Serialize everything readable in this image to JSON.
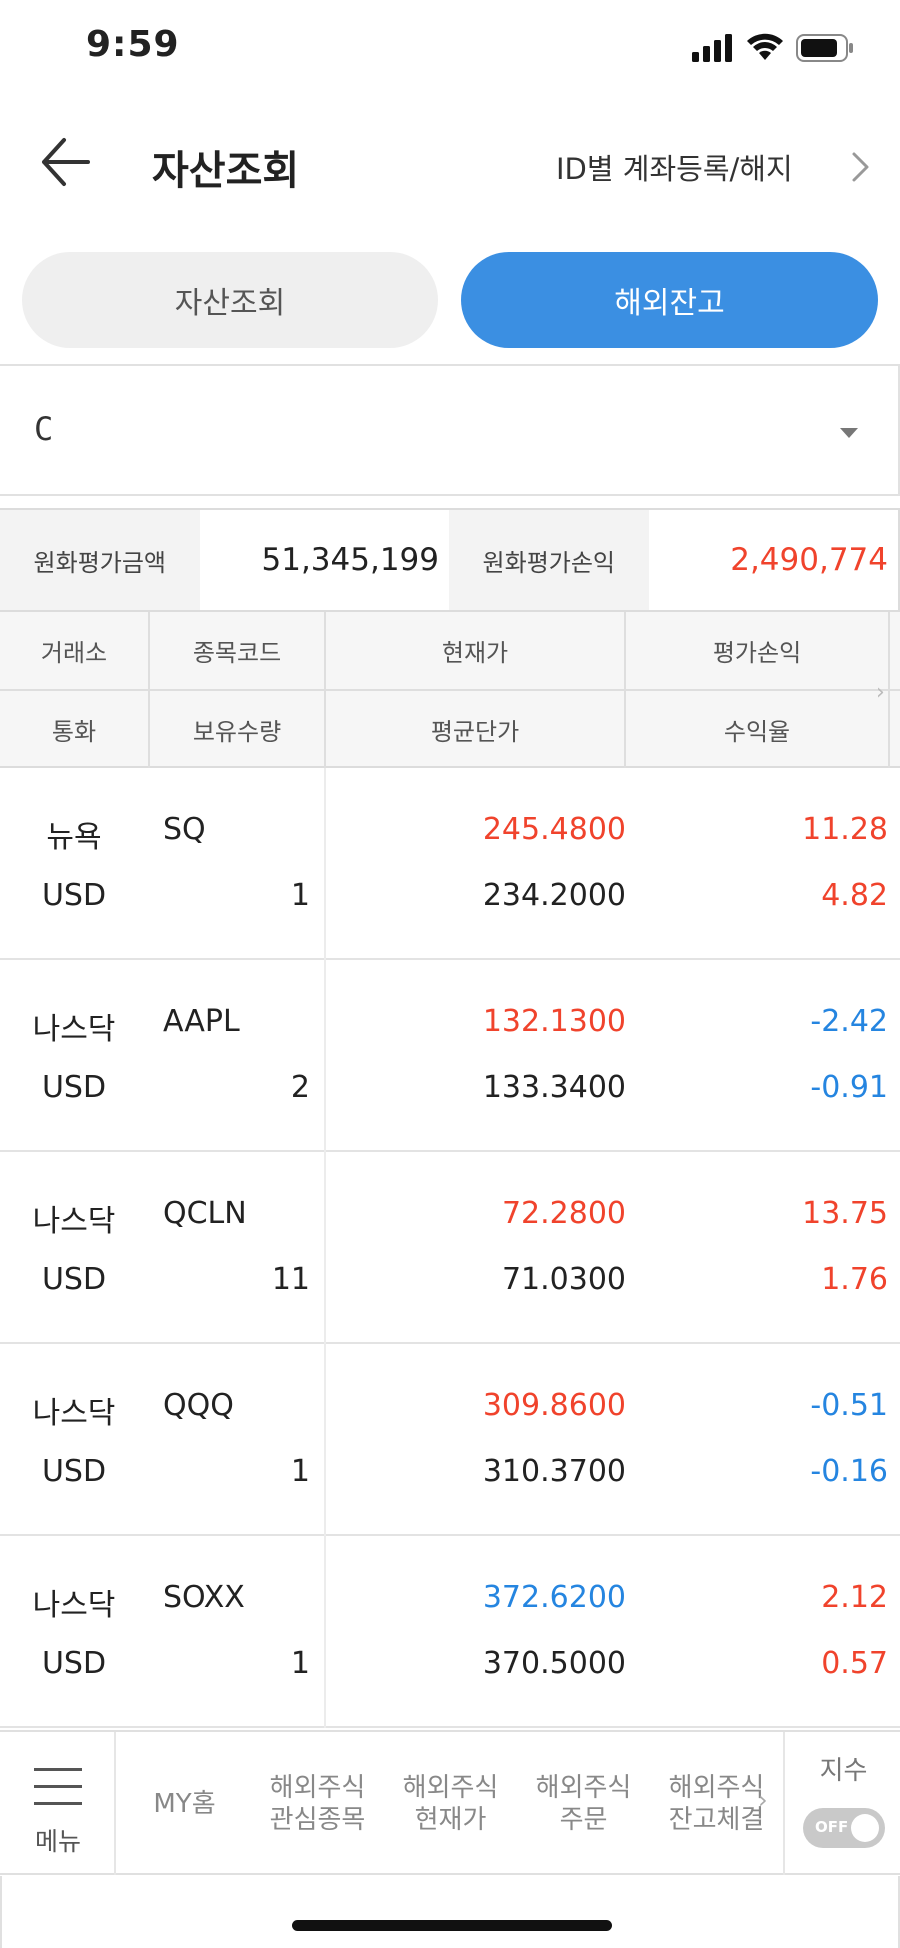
{
  "status": {
    "time": "9:59"
  },
  "header": {
    "title": "자산조회",
    "link": "ID별 계좌등록/해지"
  },
  "tabs": [
    {
      "label": "자산조회",
      "active": false
    },
    {
      "label": "해외잔고",
      "active": true
    }
  ],
  "account": {
    "value": "C"
  },
  "summary": {
    "krw_eval_amount_label": "원화평가금액",
    "krw_eval_amount": "51,345,199",
    "krw_eval_pl_label": "원화평가손익",
    "krw_eval_pl": "2,490,774"
  },
  "columns": {
    "exchange": "거래소",
    "code": "종목코드",
    "price": "현재가",
    "pl": "평가손익",
    "currency": "통화",
    "qty": "보유수량",
    "avg": "평균단가",
    "rate": "수익율"
  },
  "rows": [
    {
      "exchange": "뉴욕",
      "code": "SQ",
      "currency": "USD",
      "qty": "1",
      "price": "245.4800",
      "avg": "234.2000",
      "pl": "11.28",
      "rate": "4.82",
      "price_dir": "up",
      "pl_dir": "up"
    },
    {
      "exchange": "나스닥",
      "code": "AAPL",
      "currency": "USD",
      "qty": "2",
      "price": "132.1300",
      "avg": "133.3400",
      "pl": "-2.42",
      "rate": "-0.91",
      "price_dir": "up",
      "pl_dir": "down"
    },
    {
      "exchange": "나스닥",
      "code": "QCLN",
      "currency": "USD",
      "qty": "11",
      "price": "72.2800",
      "avg": "71.0300",
      "pl": "13.75",
      "rate": "1.76",
      "price_dir": "up",
      "pl_dir": "up"
    },
    {
      "exchange": "나스닥",
      "code": "QQQ",
      "currency": "USD",
      "qty": "1",
      "price": "309.8600",
      "avg": "310.3700",
      "pl": "-0.51",
      "rate": "-0.16",
      "price_dir": "up",
      "pl_dir": "down"
    },
    {
      "exchange": "나스닥",
      "code": "SOXX",
      "currency": "USD",
      "qty": "1",
      "price": "372.6200",
      "avg": "370.5000",
      "pl": "2.12",
      "rate": "0.57",
      "price_dir": "down",
      "pl_dir": "up"
    }
  ],
  "bottom_nav": {
    "menu_label": "메뉴",
    "items": [
      "MY홈",
      "해외주식\n관심종목",
      "해외주식\n현재가",
      "해외주식\n주문",
      "해외주식\n잔고체결"
    ],
    "index_label": "지수",
    "toggle_label": "OFF"
  },
  "colors": {
    "accent": "#3b8fe2",
    "up": "#f0432c",
    "down": "#2585e0"
  }
}
